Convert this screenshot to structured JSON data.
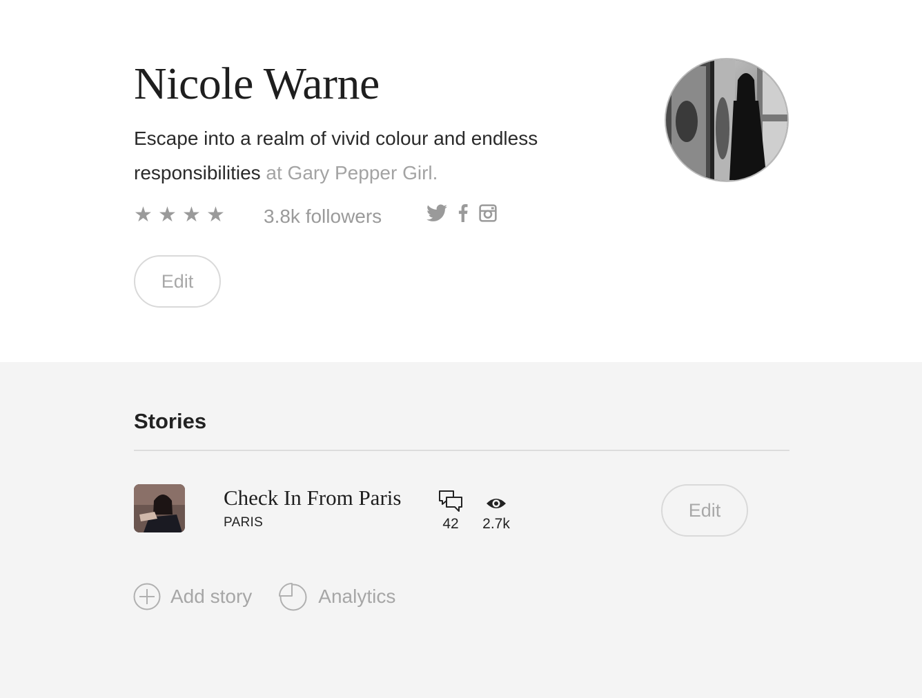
{
  "profile": {
    "name": "Nicole Warne",
    "bio": "Escape into a realm of vivid colour and endless responsibilities",
    "publication": " at Gary Pepper Girl.",
    "rating_stars": 4,
    "followers": "3.8k followers",
    "social": [
      "twitter-icon",
      "facebook-icon",
      "instagram-icon"
    ],
    "edit_label": "Edit"
  },
  "stories": {
    "title": "Stories",
    "items": [
      {
        "title": "Check In From Paris",
        "location": "PARIS",
        "comments": "42",
        "views": "2.7k",
        "edit_label": "Edit"
      }
    ],
    "actions": {
      "add_story": "Add story",
      "analytics": "Analytics"
    }
  },
  "colors": {
    "muted_text": "#a3a3a3",
    "section_bg": "#f4f4f4",
    "border": "#d9d9d9"
  }
}
